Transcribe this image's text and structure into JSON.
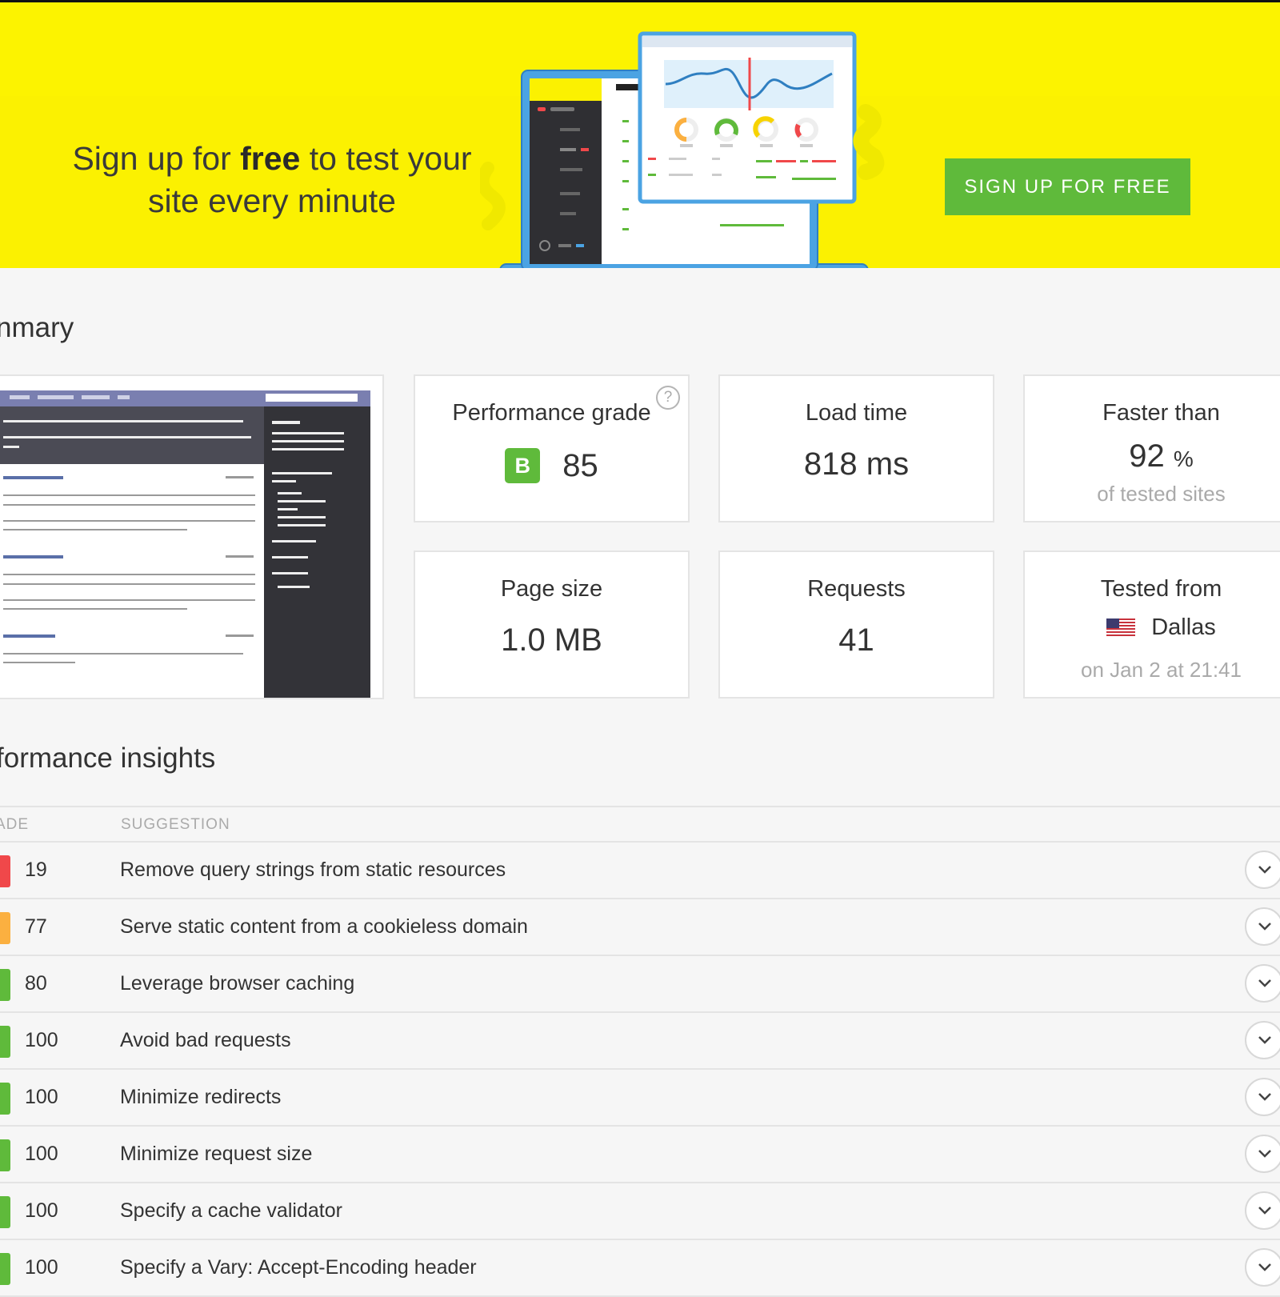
{
  "banner": {
    "headline_part1": "Sign up for ",
    "headline_bold": "free",
    "headline_part2": " to test your site every minute",
    "cta_label": "SIGN UP FOR FREE"
  },
  "summary": {
    "title": "nmary",
    "performance": {
      "label": "Performance grade",
      "grade": "B",
      "score": "85",
      "help_icon": "question-icon"
    },
    "load_time": {
      "label": "Load time",
      "value": "818 ms"
    },
    "faster_than": {
      "label": "Faster than",
      "value": "92",
      "unit": "%",
      "sub": "of tested sites"
    },
    "page_size": {
      "label": "Page size",
      "value": "1.0 MB"
    },
    "requests": {
      "label": "Requests",
      "value": "41"
    },
    "tested_from": {
      "label": "Tested from",
      "city": "Dallas",
      "flag_icon": "us-flag-icon",
      "date": "on Jan 2 at 21:41"
    }
  },
  "insights": {
    "title": "formance insights",
    "columns": {
      "grade": "ADE",
      "suggestion": "SUGGESTION"
    },
    "rows": [
      {
        "score": "19",
        "text": "Remove query strings from static resources",
        "color": "#f0484a"
      },
      {
        "score": "77",
        "text": "Serve static content from a cookieless domain",
        "color": "#fbb040"
      },
      {
        "score": "80",
        "text": "Leverage browser caching",
        "color": "#5fba3b"
      },
      {
        "score": "100",
        "text": "Avoid bad requests",
        "color": "#5fba3b"
      },
      {
        "score": "100",
        "text": "Minimize redirects",
        "color": "#5fba3b"
      },
      {
        "score": "100",
        "text": "Minimize request size",
        "color": "#5fba3b"
      },
      {
        "score": "100",
        "text": "Specify a cache validator",
        "color": "#5fba3b"
      },
      {
        "score": "100",
        "text": "Specify a Vary: Accept-Encoding header",
        "color": "#5fba3b"
      }
    ]
  },
  "colors": {
    "banner_yellow": "#fbf101",
    "button_green": "#5fba3b",
    "grade_green": "#5fba3b"
  }
}
